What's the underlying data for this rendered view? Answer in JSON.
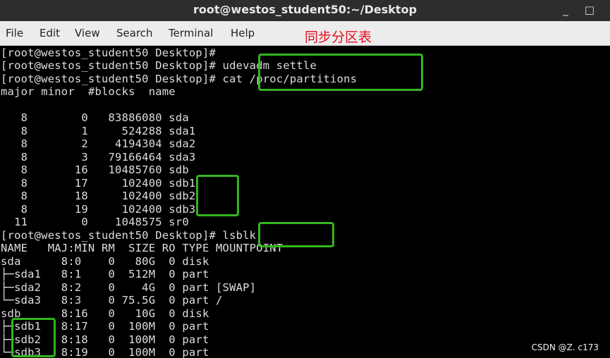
{
  "window": {
    "title": "root@westos_student50:~/Desktop",
    "minimize_label": "_",
    "maximize_label": "□"
  },
  "menu": [
    "File",
    "Edit",
    "View",
    "Search",
    "Terminal",
    "Help"
  ],
  "annotation": "同步分区表",
  "terminal_lines": [
    "[root@westos_student50 Desktop]#",
    "[root@westos_student50 Desktop]# udevadm settle",
    "[root@westos_student50 Desktop]# cat /proc/partitions",
    "major minor  #blocks  name",
    "",
    "   8        0   83886080 sda",
    "   8        1     524288 sda1",
    "   8        2    4194304 sda2",
    "   8        3   79166464 sda3",
    "   8       16   10485760 sdb",
    "   8       17     102400 sdb1",
    "   8       18     102400 sdb2",
    "   8       19     102400 sdb3",
    "  11        0    1048575 sr0",
    "[root@westos_student50 Desktop]# lsblk",
    "NAME   MAJ:MIN RM  SIZE RO TYPE MOUNTPOINT",
    "sda      8:0    0   80G  0 disk",
    "├─sda1   8:1    0  512M  0 part",
    "├─sda2   8:2    0    4G  0 part [SWAP]",
    "└─sda3   8:3    0 75.5G  0 part /",
    "sdb      8:16   0   10G  0 disk",
    "├─sdb1   8:17   0  100M  0 part",
    "├─sdb2   8:18   0  100M  0 part",
    "└─sdb3   8:19   0  100M  0 part"
  ],
  "watermark": "CSDN @Z. c173",
  "colors": {
    "highlight_box": "#33b51e",
    "annotation_text": "#e0111b",
    "terminal_bg": "#000000",
    "terminal_fg": "#dedede"
  }
}
